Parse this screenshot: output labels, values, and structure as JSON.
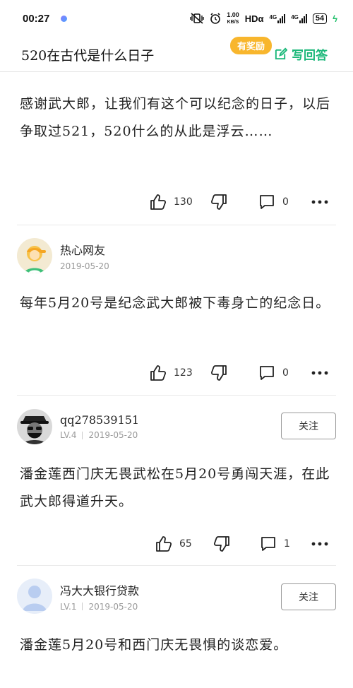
{
  "status_bar": {
    "time": "00:27",
    "speed_value": "1.00",
    "speed_unit": "KB/S",
    "network_hd": "HDα",
    "signal1": "4G",
    "signal2": "4G",
    "battery": "54"
  },
  "header": {
    "question_title": "520在古代是什么日子",
    "reward_badge": "有奖励",
    "write_answer_label": "写回答",
    "accent_color": "#1cb87a"
  },
  "answers": [
    {
      "text": "感谢武大郎，让我们有这个可以纪念的日子，以后争取过521，520什么的从此是浮云……",
      "likes": "130",
      "comments": "0"
    },
    {
      "author": "热心网友",
      "date": "2019-05-20",
      "text": "每年5月20号是纪念武大郎被下毒身亡的纪念日。",
      "likes": "123",
      "comments": "0"
    },
    {
      "author": "qq278539151",
      "level": "LV.4",
      "date": "2019-05-20",
      "follow_label": "关注",
      "text": "潘金莲西门庆无畏武松在5月20号勇闯天涯，在此武大郎得道升天。",
      "likes": "65",
      "comments": "1"
    },
    {
      "author": "冯大大银行贷款",
      "level": "LV.1",
      "date": "2019-05-20",
      "follow_label": "关注",
      "text": "潘金莲5月20号和西门庆无畏惧的谈恋爱。"
    }
  ]
}
